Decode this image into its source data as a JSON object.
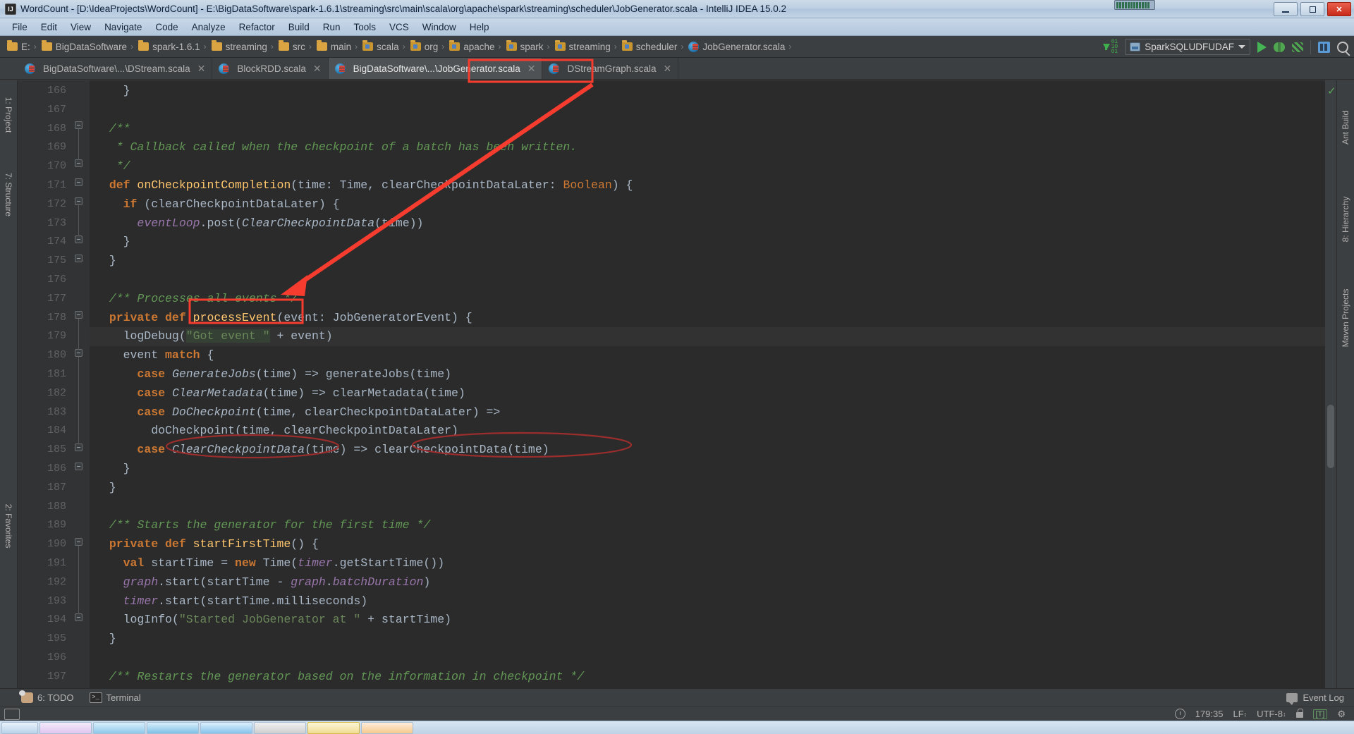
{
  "window": {
    "title": "WordCount - [D:\\IdeaProjects\\WordCount] - E:\\BigDataSoftware\\spark-1.6.1\\streaming\\src\\main\\scala\\org\\apache\\spark\\streaming\\scheduler\\JobGenerator.scala - IntelliJ IDEA 15.0.2",
    "app_icon": "IJ",
    "minimize": "–",
    "maximize": "□",
    "close": "✕"
  },
  "menu": [
    {
      "label": "File"
    },
    {
      "label": "Edit"
    },
    {
      "label": "View"
    },
    {
      "label": "Navigate"
    },
    {
      "label": "Code"
    },
    {
      "label": "Analyze"
    },
    {
      "label": "Refactor"
    },
    {
      "label": "Build"
    },
    {
      "label": "Run"
    },
    {
      "label": "Tools"
    },
    {
      "label": "VCS"
    },
    {
      "label": "Window"
    },
    {
      "label": "Help"
    }
  ],
  "breadcrumbs": [
    {
      "label": "E:",
      "icon": "folder-icon"
    },
    {
      "label": "BigDataSoftware",
      "icon": "folder-icon"
    },
    {
      "label": "spark-1.6.1",
      "icon": "folder-icon"
    },
    {
      "label": "streaming",
      "icon": "folder-icon"
    },
    {
      "label": "src",
      "icon": "folder-icon"
    },
    {
      "label": "main",
      "icon": "folder-icon"
    },
    {
      "label": "scala",
      "icon": "package-folder-icon"
    },
    {
      "label": "org",
      "icon": "package-folder-icon"
    },
    {
      "label": "apache",
      "icon": "package-folder-icon"
    },
    {
      "label": "spark",
      "icon": "package-folder-icon"
    },
    {
      "label": "streaming",
      "icon": "package-folder-icon"
    },
    {
      "label": "scheduler",
      "icon": "package-folder-icon"
    },
    {
      "label": "JobGenerator.scala",
      "icon": "scala-file-icon"
    }
  ],
  "toolbar": {
    "run_config": "SparkSQLUDFUDAF",
    "update_icon": "update-project-icon",
    "run_icon": "run-icon",
    "debug_icon": "debug-icon",
    "run_coverage_icon": "run-with-coverage-icon",
    "build_icon": "build-project-icon",
    "search_icon": "search-everywhere-icon"
  },
  "tabs": [
    {
      "label": "BigDataSoftware\\...\\DStream.scala",
      "active": false,
      "close": "✕"
    },
    {
      "label": "BlockRDD.scala",
      "active": false,
      "close": "✕"
    },
    {
      "label": "BigDataSoftware\\...\\JobGenerator.scala",
      "active": true,
      "close": "✕"
    },
    {
      "label": "DStreamGraph.scala",
      "active": false,
      "close": "✕"
    }
  ],
  "left_tool_window": [
    {
      "label": "1: Project"
    },
    {
      "label": "7: Structure"
    },
    {
      "label": "2: Favorites"
    }
  ],
  "right_tool_window": [
    {
      "label": "Ant Build"
    },
    {
      "label": "8: Hierarchy"
    },
    {
      "label": "Maven Projects"
    }
  ],
  "editor": {
    "first_line": 166,
    "lines": [
      {
        "n": 166,
        "fold": false,
        "current": false,
        "tokens": [
          {
            "t": "    }",
            "c": "pl"
          }
        ]
      },
      {
        "n": 167,
        "fold": false,
        "current": false,
        "tokens": [
          {
            "t": "",
            "c": "pl"
          }
        ]
      },
      {
        "n": 168,
        "fold": true,
        "current": false,
        "tokens": [
          {
            "t": "  /**",
            "c": "cm"
          }
        ]
      },
      {
        "n": 169,
        "fold": false,
        "current": false,
        "tokens": [
          {
            "t": "   * Callback called when the checkpoint of a batch has been written.",
            "c": "cm"
          }
        ]
      },
      {
        "n": 170,
        "fold": true,
        "current": false,
        "tokens": [
          {
            "t": "   */",
            "c": "cm"
          }
        ]
      },
      {
        "n": 171,
        "fold": true,
        "current": false,
        "tokens": [
          {
            "t": "  ",
            "c": "pl"
          },
          {
            "t": "def ",
            "c": "kwb"
          },
          {
            "t": "onCheckpointCompletion",
            "c": "fn"
          },
          {
            "t": "(time: Time, clearCheckpointDataLater: ",
            "c": "pl"
          },
          {
            "t": "Boolean",
            "c": "kw"
          },
          {
            "t": ") {",
            "c": "pl"
          }
        ]
      },
      {
        "n": 172,
        "fold": true,
        "current": false,
        "tokens": [
          {
            "t": "    ",
            "c": "pl"
          },
          {
            "t": "if ",
            "c": "kwb"
          },
          {
            "t": "(clearCheckpointDataLater) {",
            "c": "pl"
          }
        ]
      },
      {
        "n": 173,
        "fold": false,
        "current": false,
        "tokens": [
          {
            "t": "      ",
            "c": "pl"
          },
          {
            "t": "eventLoop",
            "c": "pur"
          },
          {
            "t": ".post(",
            "c": "pl"
          },
          {
            "t": "ClearCheckpointData",
            "c": "ita"
          },
          {
            "t": "(time))",
            "c": "pl"
          }
        ]
      },
      {
        "n": 174,
        "fold": true,
        "current": false,
        "tokens": [
          {
            "t": "    }",
            "c": "pl"
          }
        ]
      },
      {
        "n": 175,
        "fold": true,
        "current": false,
        "tokens": [
          {
            "t": "  }",
            "c": "pl"
          }
        ]
      },
      {
        "n": 176,
        "fold": false,
        "current": false,
        "tokens": [
          {
            "t": "",
            "c": "pl"
          }
        ]
      },
      {
        "n": 177,
        "fold": false,
        "current": false,
        "tokens": [
          {
            "t": "  /** Processes all events */",
            "c": "cm"
          }
        ]
      },
      {
        "n": 178,
        "fold": true,
        "current": false,
        "tokens": [
          {
            "t": "  ",
            "c": "pl"
          },
          {
            "t": "private def ",
            "c": "kwb"
          },
          {
            "t": "processEvent",
            "c": "fn"
          },
          {
            "t": "(event: JobGeneratorEvent) {",
            "c": "pl"
          }
        ]
      },
      {
        "n": 179,
        "fold": false,
        "current": true,
        "tokens": [
          {
            "t": "    logDebug(",
            "c": "pl"
          },
          {
            "t": "\"Got event \"",
            "c": "str"
          },
          {
            "t": " + event)",
            "c": "pl"
          }
        ]
      },
      {
        "n": 180,
        "fold": true,
        "current": false,
        "tokens": [
          {
            "t": "    event ",
            "c": "pl"
          },
          {
            "t": "match ",
            "c": "kwb"
          },
          {
            "t": "{",
            "c": "pl"
          }
        ]
      },
      {
        "n": 181,
        "fold": false,
        "current": false,
        "tokens": [
          {
            "t": "      ",
            "c": "pl"
          },
          {
            "t": "case ",
            "c": "kwb"
          },
          {
            "t": "GenerateJobs",
            "c": "ita"
          },
          {
            "t": "(time) => generateJobs(time)",
            "c": "pl"
          }
        ]
      },
      {
        "n": 182,
        "fold": false,
        "current": false,
        "tokens": [
          {
            "t": "      ",
            "c": "pl"
          },
          {
            "t": "case ",
            "c": "kwb"
          },
          {
            "t": "ClearMetadata",
            "c": "ita"
          },
          {
            "t": "(time) => clearMetadata(time)",
            "c": "pl"
          }
        ]
      },
      {
        "n": 183,
        "fold": false,
        "current": false,
        "tokens": [
          {
            "t": "      ",
            "c": "pl"
          },
          {
            "t": "case ",
            "c": "kwb"
          },
          {
            "t": "DoCheckpoint",
            "c": "ita"
          },
          {
            "t": "(time, clearCheckpointDataLater) =>",
            "c": "pl"
          }
        ]
      },
      {
        "n": 184,
        "fold": false,
        "current": false,
        "tokens": [
          {
            "t": "        doCheckpoint(time, clearCheckpointDataLater)",
            "c": "pl"
          }
        ]
      },
      {
        "n": 185,
        "fold": false,
        "current": false,
        "tokens": [
          {
            "t": "      ",
            "c": "pl"
          },
          {
            "t": "case ",
            "c": "kwb"
          },
          {
            "t": "ClearCheckpointData",
            "c": "ita"
          },
          {
            "t": "(time) => clearCheckpointData(time)",
            "c": "pl"
          }
        ]
      },
      {
        "n": 186,
        "fold": true,
        "current": false,
        "tokens": [
          {
            "t": "    }",
            "c": "pl"
          }
        ]
      },
      {
        "n": 187,
        "fold": true,
        "current": false,
        "tokens": [
          {
            "t": "  }",
            "c": "pl"
          }
        ]
      },
      {
        "n": 188,
        "fold": false,
        "current": false,
        "tokens": [
          {
            "t": "",
            "c": "pl"
          }
        ]
      },
      {
        "n": 189,
        "fold": false,
        "current": false,
        "tokens": [
          {
            "t": "  /** Starts the generator for the first time */",
            "c": "cm"
          }
        ]
      },
      {
        "n": 190,
        "fold": true,
        "current": false,
        "tokens": [
          {
            "t": "  ",
            "c": "pl"
          },
          {
            "t": "private def ",
            "c": "kwb"
          },
          {
            "t": "startFirstTime",
            "c": "fn"
          },
          {
            "t": "() {",
            "c": "pl"
          }
        ]
      },
      {
        "n": 191,
        "fold": false,
        "current": false,
        "tokens": [
          {
            "t": "    ",
            "c": "pl"
          },
          {
            "t": "val ",
            "c": "kwb"
          },
          {
            "t": "startTime = ",
            "c": "pl"
          },
          {
            "t": "new ",
            "c": "kwb"
          },
          {
            "t": "Time(",
            "c": "pl"
          },
          {
            "t": "timer",
            "c": "pur"
          },
          {
            "t": ".getStartTime())",
            "c": "pl"
          }
        ]
      },
      {
        "n": 192,
        "fold": false,
        "current": false,
        "tokens": [
          {
            "t": "    ",
            "c": "pl"
          },
          {
            "t": "graph",
            "c": "pur"
          },
          {
            "t": ".start(startTime - ",
            "c": "pl"
          },
          {
            "t": "graph",
            "c": "pur"
          },
          {
            "t": ".",
            "c": "pl"
          },
          {
            "t": "batchDuration",
            "c": "pur"
          },
          {
            "t": ")",
            "c": "pl"
          }
        ]
      },
      {
        "n": 193,
        "fold": false,
        "current": false,
        "tokens": [
          {
            "t": "    ",
            "c": "pl"
          },
          {
            "t": "timer",
            "c": "pur"
          },
          {
            "t": ".start(startTime.milliseconds)",
            "c": "pl"
          }
        ]
      },
      {
        "n": 194,
        "fold": false,
        "current": false,
        "tokens": [
          {
            "t": "    logInfo(",
            "c": "pl"
          },
          {
            "t": "\"Started JobGenerator at \"",
            "c": "str"
          },
          {
            "t": " + startTime)",
            "c": "pl"
          }
        ]
      },
      {
        "n": 195,
        "fold": true,
        "current": false,
        "tokens": [
          {
            "t": "  }",
            "c": "pl"
          }
        ]
      },
      {
        "n": 196,
        "fold": false,
        "current": false,
        "tokens": [
          {
            "t": "",
            "c": "pl"
          }
        ]
      },
      {
        "n": 197,
        "fold": false,
        "current": false,
        "tokens": [
          {
            "t": "  /** Restarts the generator based on the information in checkpoint */",
            "c": "cm"
          }
        ]
      }
    ]
  },
  "annotations": {
    "tab_box_label": "JobGenerator.scala",
    "method_box_label": "processEvent",
    "arrow_color": "#f53c2e",
    "ellipse_color": "#9b2d2d",
    "ellipse_labels": [
      "ClearCheckpointData(time)",
      "clearCheckpointData(time)"
    ]
  },
  "tool_windows_bottom": [
    {
      "label": "6: TODO",
      "icon": "todo-icon"
    },
    {
      "label": "Terminal",
      "icon": "terminal-icon"
    }
  ],
  "event_log": {
    "label": "Event Log",
    "icon": "event-log-icon"
  },
  "status_bar": {
    "caret_position": "179:35",
    "line_separator": "LF",
    "encoding": "UTF-8",
    "lock_icon": "read-only-lock-icon",
    "tab_marker": "[T]",
    "clock_icon": "background-tasks-icon",
    "sep_updown": "↕"
  },
  "taskbar": {
    "buttons": [
      "start",
      "c1",
      "c2",
      "c3",
      "c4",
      "c5",
      "sel",
      "c7"
    ]
  },
  "colors": {
    "editor_bg": "#2b2b2b",
    "gutter_bg": "#313335",
    "chrome_bg": "#3c3f41",
    "accent_red": "#f53c2e",
    "keyword": "#cc7832",
    "comment": "#629755",
    "string": "#6a8759",
    "method": "#ffc66d",
    "field": "#9876aa",
    "plain": "#a9b7c6"
  }
}
